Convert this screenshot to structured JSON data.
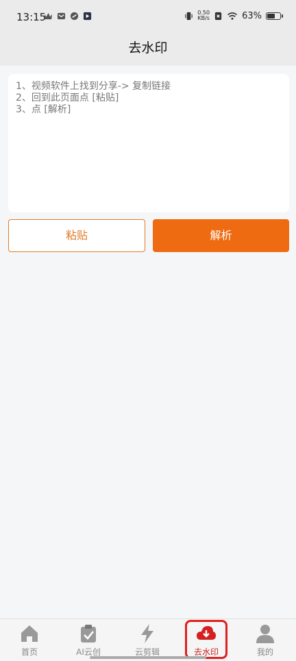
{
  "status": {
    "time": "13:15",
    "net_speed_value": "0.50",
    "net_speed_unit": "KB/s",
    "battery_percent": "63%",
    "battery_level": 0.63
  },
  "header": {
    "title": "去水印"
  },
  "main": {
    "instructions": "1、视频软件上找到分享-> 复制链接\n2、回到此页面点 [粘贴]\n3、点 [解析]",
    "paste_label": "粘贴",
    "parse_label": "解析"
  },
  "tabs": [
    {
      "label": "首页",
      "icon": "home-icon"
    },
    {
      "label": "AI云创",
      "icon": "clipboard-check-icon"
    },
    {
      "label": "云剪辑",
      "icon": "lightning-icon"
    },
    {
      "label": "去水印",
      "icon": "cloud-download-icon",
      "active": true
    },
    {
      "label": "我的",
      "icon": "user-icon"
    }
  ],
  "colors": {
    "accent": "#ee6b12",
    "active_tab": "#cc1f1f",
    "highlight": "#e01e1e"
  }
}
